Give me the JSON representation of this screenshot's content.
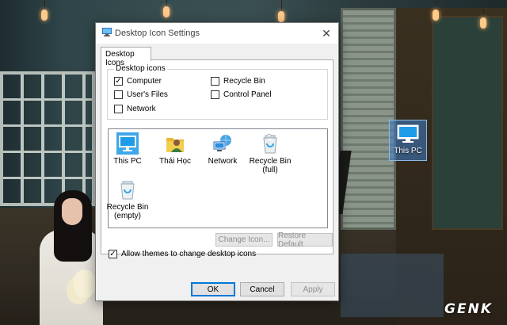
{
  "dialog": {
    "title": "Desktop Icon Settings",
    "close_glyph": "✕",
    "tab_label": "Desktop Icons",
    "group_label": "Desktop icons",
    "checkboxes": [
      {
        "label": "Computer",
        "checked": true
      },
      {
        "label": "Recycle Bin",
        "checked": false
      },
      {
        "label": "User's Files",
        "checked": false
      },
      {
        "label": "Control Panel",
        "checked": false
      },
      {
        "label": "Network",
        "checked": false
      }
    ],
    "check_glyph": "✓",
    "icon_items": [
      {
        "label": "This PC",
        "icon": "monitor-icon",
        "selected": true
      },
      {
        "label": "Thái Học",
        "icon": "user-folder-icon",
        "selected": false
      },
      {
        "label": "Network",
        "icon": "network-icon",
        "selected": false
      },
      {
        "label": "Recycle Bin\n(full)",
        "icon": "recycle-bin-full-icon",
        "selected": false
      },
      {
        "label": "Recycle Bin\n(empty)",
        "icon": "recycle-bin-empty-icon",
        "selected": false
      }
    ],
    "change_icon_label": "Change Icon...",
    "restore_default_label": "Restore Default",
    "allow_themes_label": "Allow themes to change desktop icons",
    "allow_themes_checked": true,
    "ok_label": "OK",
    "cancel_label": "Cancel",
    "apply_label": "Apply"
  },
  "desktop": {
    "icon_label": "This PC",
    "icon": "monitor-icon"
  },
  "watermark": "GENK",
  "colors": {
    "accent": "#0078d7",
    "selection": "#3ea7e8",
    "dialog_bg": "#f0f0f0"
  }
}
